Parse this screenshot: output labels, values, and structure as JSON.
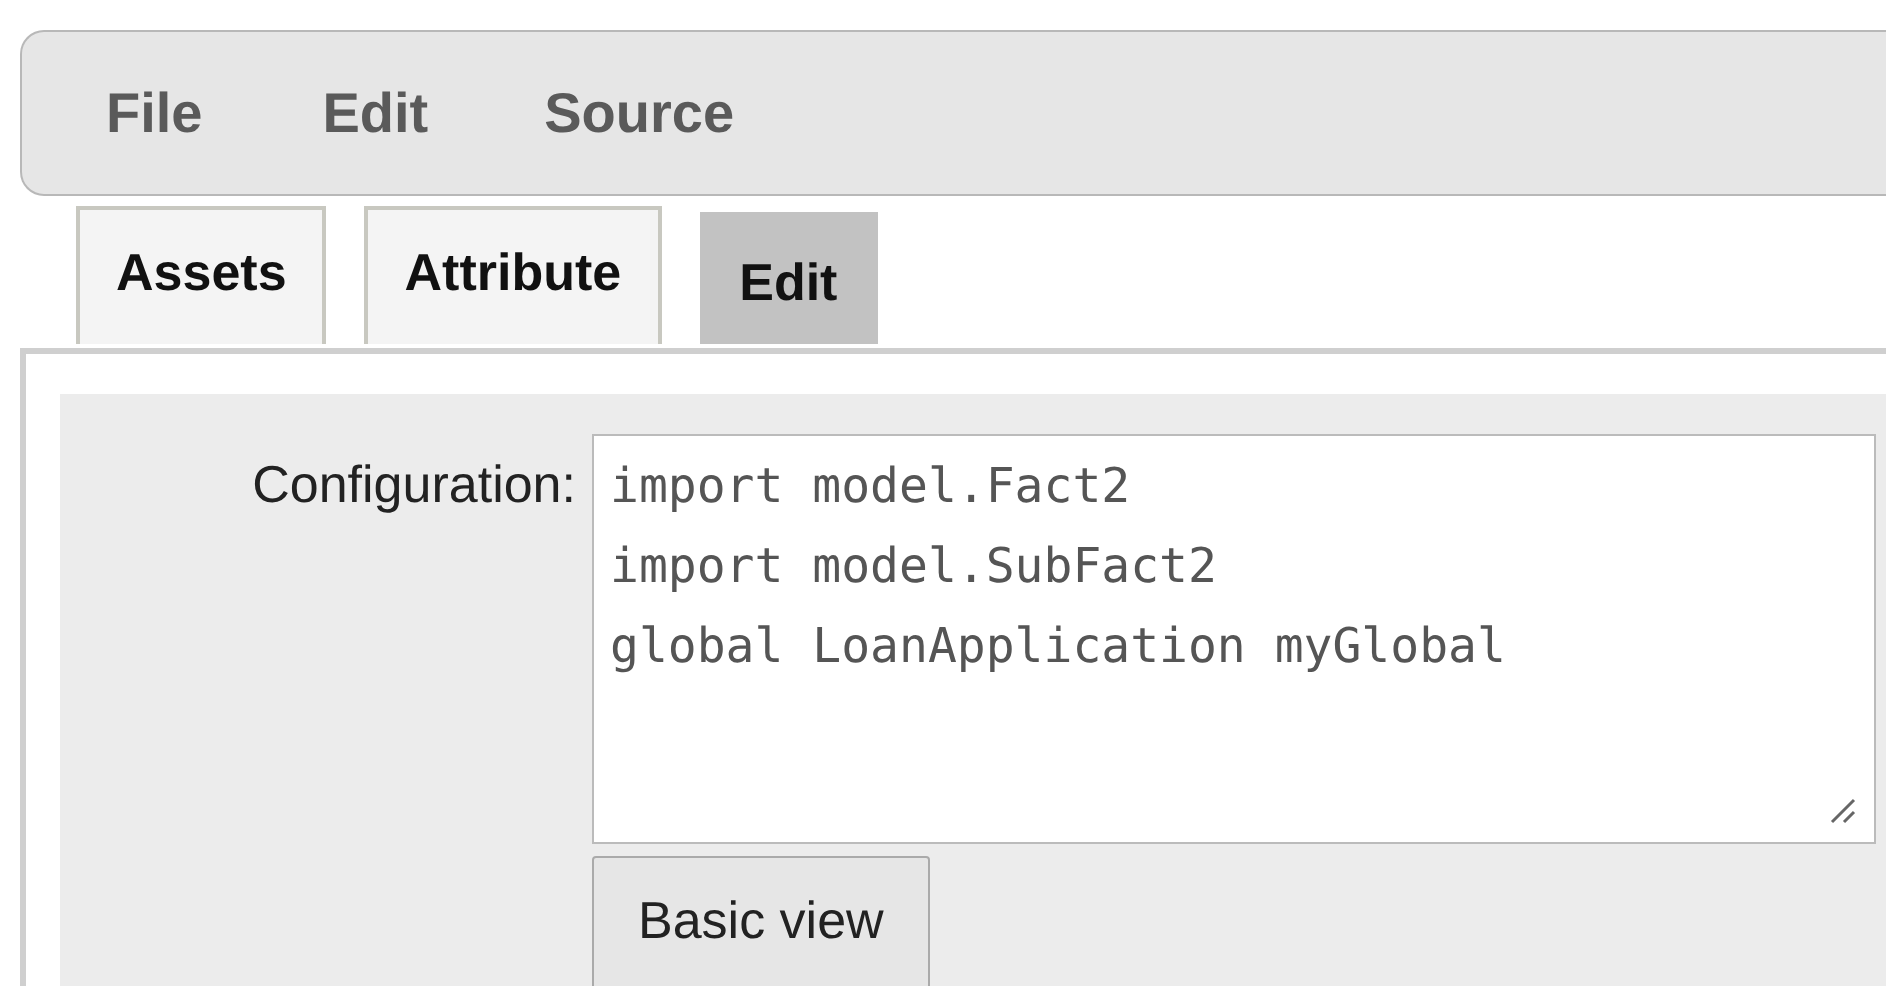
{
  "menu": [
    {
      "label": "File"
    },
    {
      "label": "Edit"
    },
    {
      "label": "Source"
    }
  ],
  "tabs": [
    {
      "label": "Assets",
      "selected": false
    },
    {
      "label": "Attribute",
      "selected": false
    },
    {
      "label": "Edit",
      "selected": true
    }
  ],
  "configuration": {
    "label": "Configuration:",
    "value": "import model.Fact2\nimport model.SubFact2\nglobal LoanApplication myGlobal"
  },
  "buttons": [
    {
      "label": "Basic view"
    }
  ]
}
